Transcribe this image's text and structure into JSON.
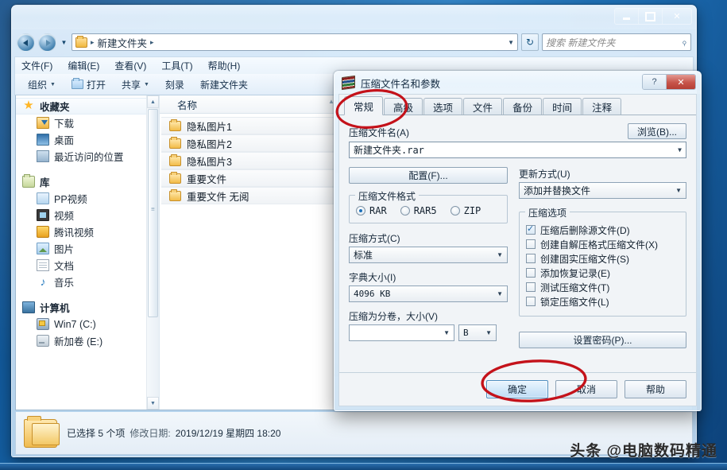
{
  "explorer": {
    "window_controls": {
      "minimize": "",
      "maximize": "",
      "close": "✕"
    },
    "address": {
      "crumb_root": "新建文件夹",
      "sep": "▸",
      "caret": "▼",
      "refresh_icon": "↻",
      "folder_icon": "folder-icon"
    },
    "search": {
      "placeholder": "搜索 新建文件夹",
      "icon": "search-icon",
      "glyph": "⌕"
    },
    "menubar": [
      "文件(F)",
      "编辑(E)",
      "查看(V)",
      "工具(T)",
      "帮助(H)"
    ],
    "toolbar": {
      "organize": "组织",
      "open": "打开",
      "share": "共享",
      "burn": "刻录",
      "new_folder": "新建文件夹",
      "caret": "▼"
    },
    "navpane": {
      "groups": [
        {
          "root": {
            "label": "收藏夹",
            "icon": "star-icon"
          },
          "children": [
            {
              "label": "下载",
              "icon": "download-folder-icon"
            },
            {
              "label": "桌面",
              "icon": "desktop-icon"
            },
            {
              "label": "最近访问的位置",
              "icon": "recent-places-icon"
            }
          ]
        },
        {
          "root": {
            "label": "库",
            "icon": "library-icon"
          },
          "children": [
            {
              "label": "PP视频",
              "icon": "pp-video-icon"
            },
            {
              "label": "视频",
              "icon": "video-icon"
            },
            {
              "label": "腾讯视频",
              "icon": "tencent-video-icon"
            },
            {
              "label": "图片",
              "icon": "pictures-icon"
            },
            {
              "label": "文档",
              "icon": "documents-icon"
            },
            {
              "label": "音乐",
              "icon": "music-icon"
            }
          ]
        },
        {
          "root": {
            "label": "计算机",
            "icon": "computer-icon"
          },
          "children": [
            {
              "label": "Win7 (C:)",
              "icon": "system-drive-icon"
            },
            {
              "label": "新加卷 (E:)",
              "icon": "drive-icon"
            }
          ]
        }
      ],
      "scroll_up": "▲",
      "scroll_down": "▼"
    },
    "filepane": {
      "column_header": "名称",
      "sort_arrow": "▲",
      "rows": [
        {
          "name": "隐私图片1"
        },
        {
          "name": "隐私图片2"
        },
        {
          "name": "隐私图片3"
        },
        {
          "name": "重要文件"
        },
        {
          "name": "重要文件 无阅"
        }
      ]
    },
    "statusbar": {
      "selected": "已选择 5 个项",
      "date_label": "修改日期:",
      "date_value": "2019/12/19 星期四 18:20"
    }
  },
  "rar_dialog": {
    "title": "压缩文件名和参数",
    "icon": "winrar-books-icon",
    "window_controls": {
      "help": "?",
      "close": "✕"
    },
    "tabs": [
      {
        "label": "常规",
        "active": true
      },
      {
        "label": "高级",
        "active": false
      },
      {
        "label": "选项",
        "active": false
      },
      {
        "label": "文件",
        "active": false
      },
      {
        "label": "备份",
        "active": false
      },
      {
        "label": "时间",
        "active": false
      },
      {
        "label": "注释",
        "active": false
      }
    ],
    "archive_name_label": "压缩文件名(A)",
    "archive_name_value": "新建文件夹.rar",
    "browse_button": "浏览(B)...",
    "profile_button": "配置(F)...",
    "update_mode_label": "更新方式(U)",
    "update_mode_value": "添加并替换文件",
    "format_group_title": "压缩文件格式",
    "format_options": [
      {
        "label": "RAR",
        "selected": true
      },
      {
        "label": "RAR5",
        "selected": false
      },
      {
        "label": "ZIP",
        "selected": false
      }
    ],
    "method_label": "压缩方式(C)",
    "method_value": "标准",
    "dict_label": "字典大小(I)",
    "dict_value": "4096 KB",
    "volume_label": "压缩为分卷，大小(V)",
    "volume_value": "",
    "volume_unit": "B",
    "options_group_title": "压缩选项",
    "options": [
      {
        "label": "压缩后删除源文件(D)",
        "checked": true
      },
      {
        "label": "创建自解压格式压缩文件(X)",
        "checked": false
      },
      {
        "label": "创建固实压缩文件(S)",
        "checked": false
      },
      {
        "label": "添加恢复记录(E)",
        "checked": false
      },
      {
        "label": "测试压缩文件(T)",
        "checked": false
      },
      {
        "label": "锁定压缩文件(L)",
        "checked": false
      }
    ],
    "password_button": "设置密码(P)...",
    "ok_button": "确定",
    "cancel_button": "取消",
    "help_button": "帮助",
    "caret": "▼"
  },
  "annotations": {
    "color": "#c4121a",
    "items": [
      {
        "name": "circle-around-general-tab",
        "target": "常规"
      },
      {
        "name": "circle-around-ok-button",
        "target": "确定"
      }
    ]
  },
  "watermark": {
    "text": "头条 @电脑数码精通"
  },
  "colors": {
    "desktop_blue": "#1666ac",
    "aero_glass": "#cde2f3",
    "annotation_red": "#c4121a",
    "folder_yellow": "#f2bc49",
    "default_button_blue": "#4f8fc0"
  }
}
